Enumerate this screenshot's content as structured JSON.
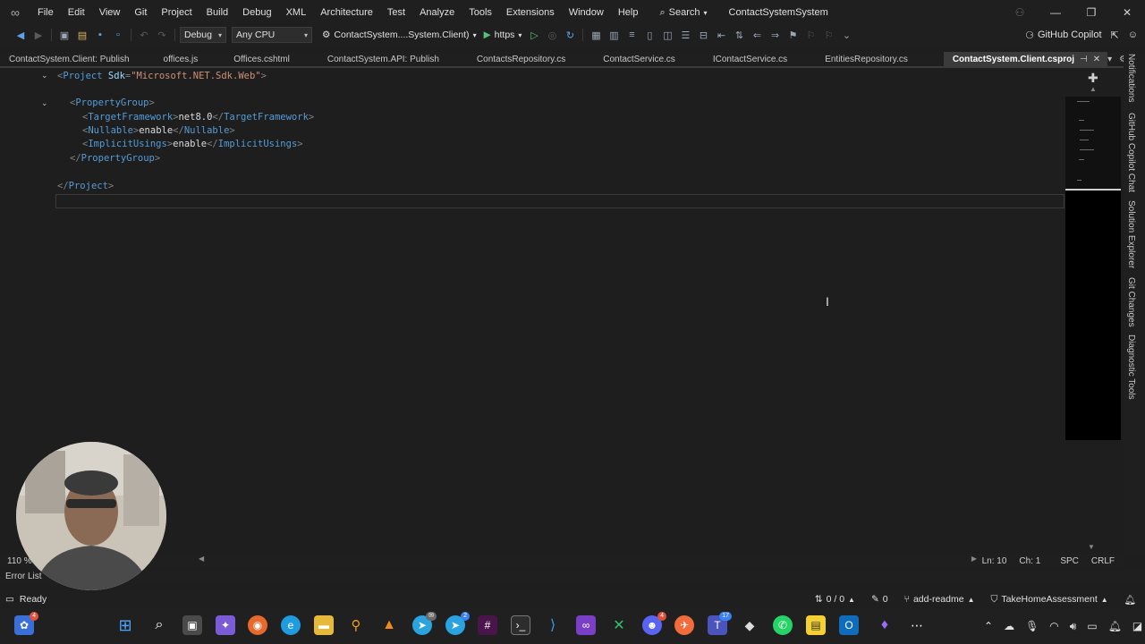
{
  "menu": [
    "File",
    "Edit",
    "View",
    "Git",
    "Project",
    "Build",
    "Debug",
    "XML",
    "Architecture",
    "Test",
    "Analyze",
    "Tools",
    "Extensions",
    "Window",
    "Help"
  ],
  "search_label": "Search",
  "solution_name": "ContactSystemSystem",
  "toolbar": {
    "config": "Debug",
    "platform": "Any CPU",
    "startup_project": "ContactSystem....System.Client)",
    "run_profile": "https",
    "copilot_label": "GitHub Copilot"
  },
  "tabs": [
    {
      "label": "ContactSystem.Client: Publish"
    },
    {
      "label": "offices.js"
    },
    {
      "label": "Offices.cshtml"
    },
    {
      "label": "ContactSystem.API: Publish"
    },
    {
      "label": "ContactsRepository.cs"
    },
    {
      "label": "ContactService.cs"
    },
    {
      "label": "IContactService.cs"
    },
    {
      "label": "EntitiesRepository.cs"
    },
    {
      "label": "ContactSystem.Client.csproj"
    }
  ],
  "code": {
    "l1": {
      "open": "<",
      "tag": "Project",
      "attr": "Sdk",
      "eq": "=",
      "val": "\"Microsoft.NET.Sdk.Web\"",
      "close": ">"
    },
    "l3": {
      "open": "<",
      "tag": "PropertyGroup",
      "close": ">"
    },
    "l4": {
      "open": "<",
      "tag": "TargetFramework",
      "mid": ">",
      "text": "net8.0",
      "endopen": "</",
      "endtag": "TargetFramework",
      "close": ">"
    },
    "l5": {
      "open": "<",
      "tag": "Nullable",
      "mid": ">",
      "text": "enable",
      "endopen": "</",
      "endtag": "Nullable",
      "close": ">"
    },
    "l6": {
      "open": "<",
      "tag": "ImplicitUsings",
      "mid": ">",
      "text": "enable",
      "endopen": "</",
      "endtag": "ImplicitUsings",
      "close": ">"
    },
    "l7": {
      "open": "</",
      "tag": "PropertyGroup",
      "close": ">"
    },
    "l9": {
      "open": "</",
      "tag": "Project",
      "close": ">"
    }
  },
  "right_rail": [
    "Notifications",
    "GitHub Copilot Chat",
    "Solution Explorer",
    "Git Changes",
    "Diagnostic Tools"
  ],
  "editor_status": {
    "zoom": "110 %",
    "line": "Ln: 10",
    "col": "Ch: 1",
    "whitespace": "SPC",
    "line_ending": "CRLF"
  },
  "error_list_label": "Error List",
  "status": {
    "ready": "Ready",
    "sync": "0 / 0",
    "changes": "0",
    "branch": "add-readme",
    "repo": "TakeHomeAssessment"
  },
  "taskbar": {
    "badges": {
      "first": "4",
      "telegram2": "2",
      "discord": "4",
      "teams": "17"
    }
  }
}
